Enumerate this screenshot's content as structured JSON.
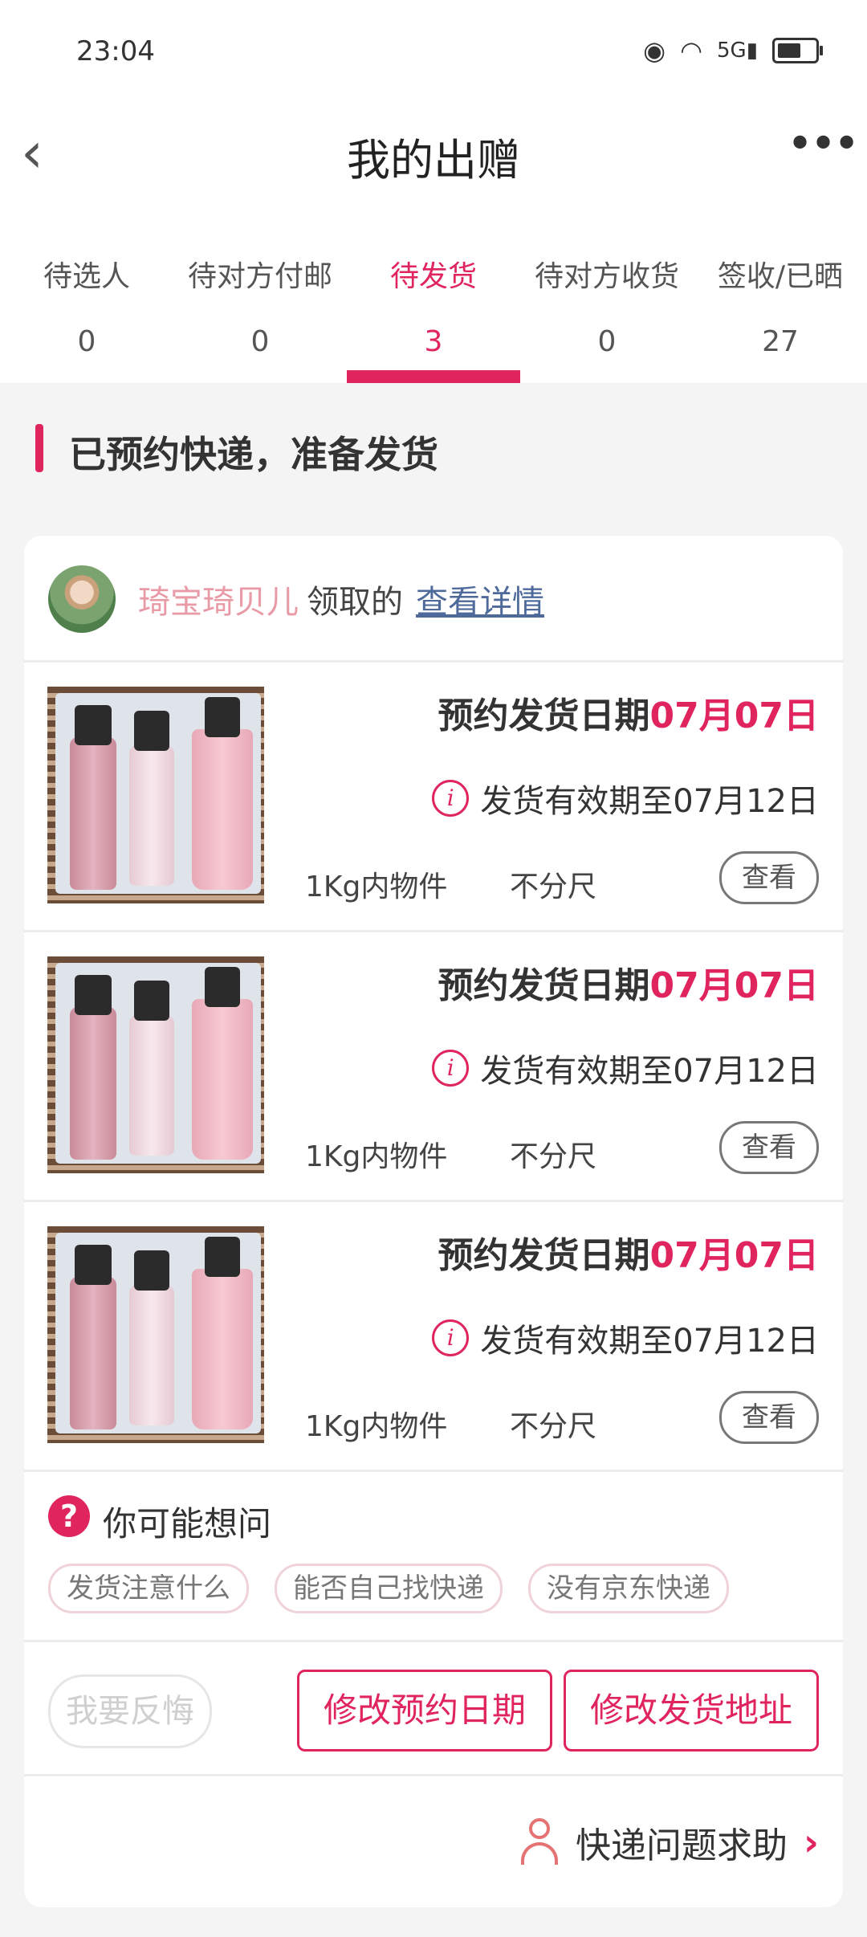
{
  "status_bar": {
    "time": "23:04",
    "icons": [
      "eye-icon",
      "wifi-icon",
      "5g-signal-icon",
      "battery-icon"
    ]
  },
  "header": {
    "title": "我的出赠",
    "back_icon": "chevron-left-icon",
    "more_icon": "more-dots-icon"
  },
  "tabs": [
    {
      "label": "待选人",
      "count": "0",
      "active": false
    },
    {
      "label": "待对方付邮",
      "count": "0",
      "active": false
    },
    {
      "label": "待发货",
      "count": "3",
      "active": true
    },
    {
      "label": "待对方收货",
      "count": "0",
      "active": false
    },
    {
      "label": "签收/已晒",
      "count": "27",
      "active": false
    }
  ],
  "section": {
    "title": "已预约快递，准备发货"
  },
  "giver": {
    "name": "琦宝琦贝儿",
    "suffix": "领取的",
    "link": "查看详情"
  },
  "items": [
    {
      "date_label": "预约发货日期",
      "date": "07月07日",
      "valid": "发货有效期至07月12日",
      "weight": "1Kg内物件",
      "size": "不分尺",
      "view": "查看"
    },
    {
      "date_label": "预约发货日期",
      "date": "07月07日",
      "valid": "发货有效期至07月12日",
      "weight": "1Kg内物件",
      "size": "不分尺",
      "view": "查看"
    },
    {
      "date_label": "预约发货日期",
      "date": "07月07日",
      "valid": "发货有效期至07月12日",
      "weight": "1Kg内物件",
      "size": "不分尺",
      "view": "查看"
    }
  ],
  "faq": {
    "title": "你可能想问",
    "chips": [
      "发货注意什么",
      "能否自己找快递",
      "没有京东快递"
    ]
  },
  "actions": {
    "regret": "我要反悔",
    "change_date": "修改预约日期",
    "change_address": "修改发货地址"
  },
  "help": {
    "text": "快递问题求助"
  },
  "colors": {
    "accent": "#e0245e",
    "link": "#4e6a9a",
    "name_pink": "#e89aa6"
  }
}
